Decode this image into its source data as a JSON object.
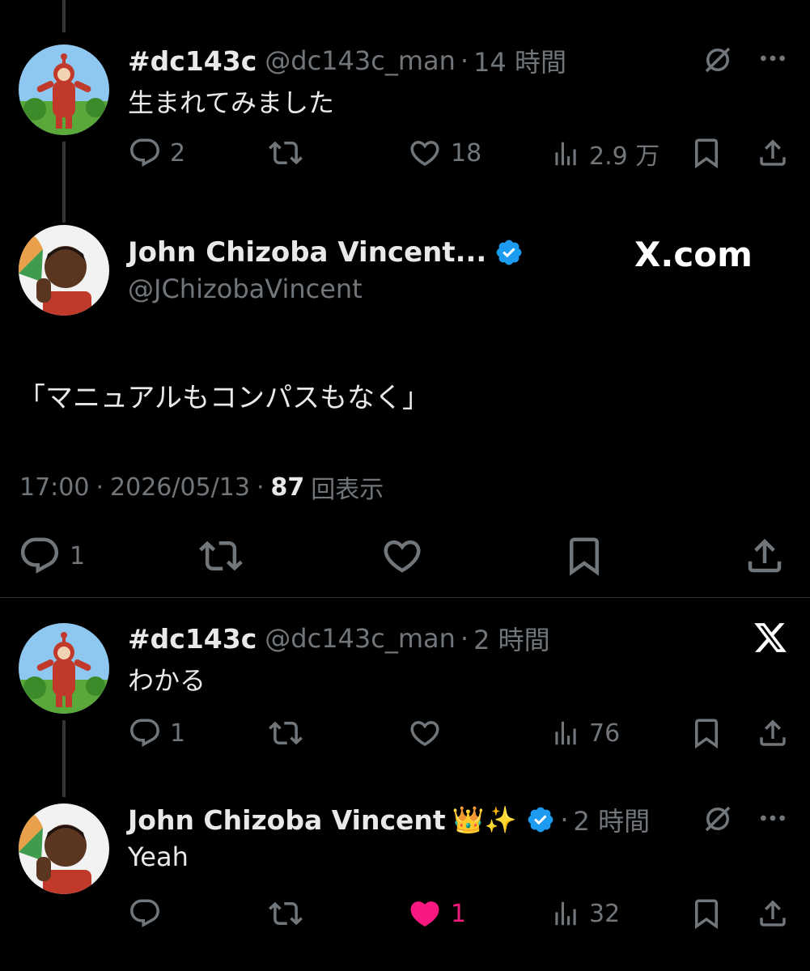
{
  "colors": {
    "background": "#000000",
    "text": "#e7e9ea",
    "muted": "#71767b",
    "verified": "#1d9bf0",
    "like_active": "#f91880"
  },
  "post1": {
    "name": "#dc143c",
    "handle": "@dc143c_man",
    "sep": "·",
    "time": "14 時間",
    "text": "生まれてみました",
    "replies": "2",
    "likes": "18",
    "views": "2.9 万"
  },
  "main_post": {
    "name": "John Chizoba Vincent...",
    "handle": "@JChizobaVincent",
    "badge_text": "X.com",
    "text": "「マニュアルもコンパスもなく」",
    "time": "17:00",
    "sep": "·",
    "date": "2026/05/13",
    "view_count": "87",
    "view_label": "回表示",
    "replies": "1"
  },
  "reply1": {
    "name": "#dc143c",
    "handle": "@dc143c_man",
    "sep": "·",
    "time": "2 時間",
    "text": "わかる",
    "replies": "1",
    "views": "76"
  },
  "reply2": {
    "name": "John Chizoba Vincent",
    "emoji": "👑✨",
    "sep": "·",
    "time": "2 時間",
    "text": "Yeah",
    "likes": "1",
    "views": "32"
  }
}
